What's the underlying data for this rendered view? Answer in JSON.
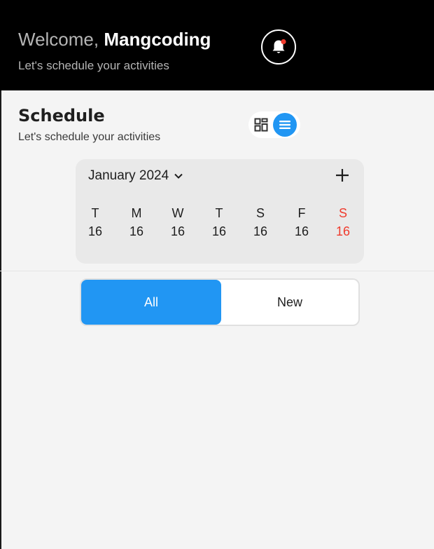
{
  "header": {
    "greeting": "Welcome,",
    "user_name": "Mangcoding",
    "subtitle": "Let's schedule your activities",
    "notification_icon": "bell-icon",
    "notification_dot_color": "#ef3b2d"
  },
  "schedule": {
    "title": "Schedule",
    "subtitle": "Let's schedule your activities",
    "view_modes": [
      "grid-view-icon",
      "list-view-icon"
    ],
    "active_view": "list",
    "accent_color": "#2196f3"
  },
  "calendar": {
    "month_label": "January 2024",
    "add_icon": "plus-icon",
    "days": [
      {
        "letter": "T",
        "date": "16",
        "weekend": false
      },
      {
        "letter": "M",
        "date": "16",
        "weekend": false
      },
      {
        "letter": "W",
        "date": "16",
        "weekend": false
      },
      {
        "letter": "T",
        "date": "16",
        "weekend": false
      },
      {
        "letter": "S",
        "date": "16",
        "weekend": false
      },
      {
        "letter": "F",
        "date": "16",
        "weekend": false
      },
      {
        "letter": "S",
        "date": "16",
        "weekend": true
      }
    ]
  },
  "filter_tabs": {
    "items": [
      "All",
      "New"
    ],
    "selected": "All"
  }
}
